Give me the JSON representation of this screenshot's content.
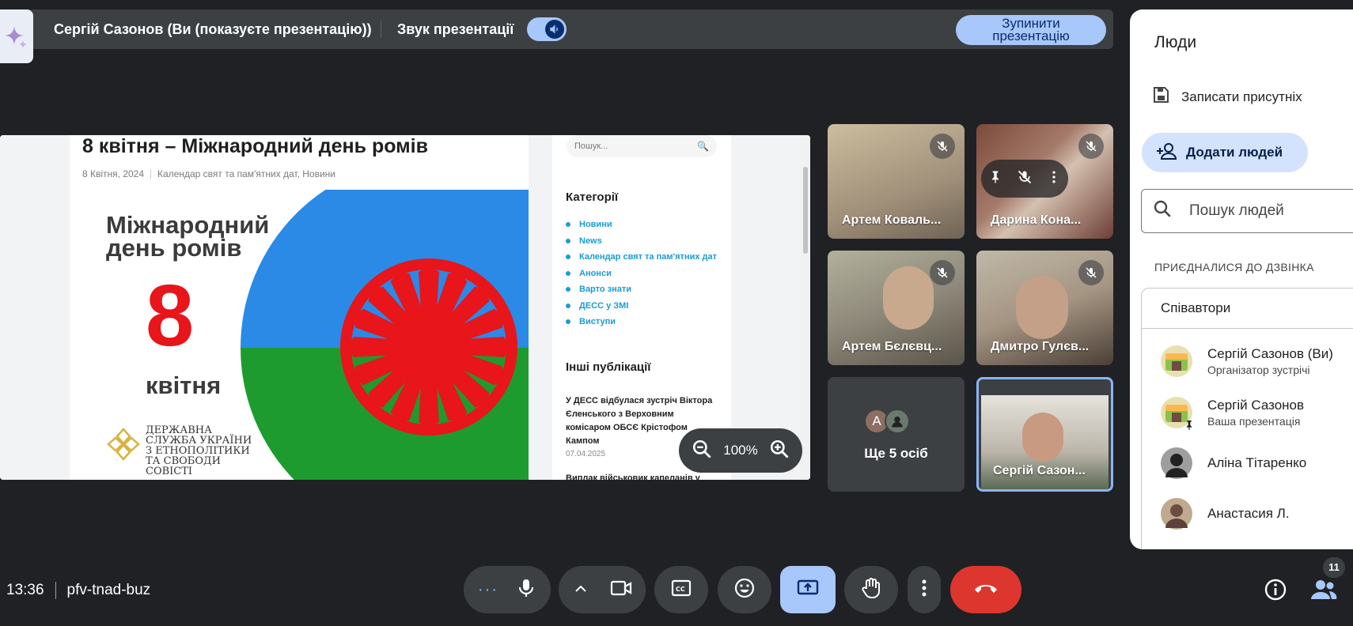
{
  "top_bar": {
    "presenter": "Сергій Сазонов (Ви (показуєте презентацію))",
    "sound_label": "Звук презентації",
    "stop_label": "Зупинити презентацію"
  },
  "presentation": {
    "article_title": "8 квітня – Міжнародний день ромів",
    "article_date": "8 Квітня, 2024",
    "article_categories": "Календар свят та пам'ятних дат, Новини",
    "poster": {
      "title_line1": "Міжнародний",
      "title_line2": "день ромів",
      "day": "8",
      "month": "квітня",
      "agency_lines": [
        "Державна",
        "служба України",
        "з етнополітики",
        "та свободи",
        "совісті"
      ]
    },
    "search_placeholder": "Пошук...",
    "categories_heading": "Категорії",
    "categories": [
      "Новини",
      "News",
      "Календар свят та пам'ятних дат",
      "Анонси",
      "Варто знати",
      "ДЕСС у ЗМІ",
      "Виступи"
    ],
    "other_heading": "Інші публікації",
    "publication_title": "У ДЕСС відбулася зустріч Віктора Єленського з Верховним комісаром ОБСЄ Крістофом Кампом",
    "publication_date": "07.04.2025",
    "next_publication": "Виплак військовик капеланів у",
    "zoom_level": "100%"
  },
  "participants": {
    "tiles": [
      {
        "name": "Артем Коваль..."
      },
      {
        "name": "Дарина Кона..."
      },
      {
        "name": "Артем Бєлєвц..."
      },
      {
        "name": "Дмитро Гулєв..."
      }
    ],
    "more_label": "Ще 5 осіб",
    "more_avatar_letter": "А",
    "self_name": "Сергій Сазон..."
  },
  "people_panel": {
    "title": "Люди",
    "record_label": "Записати присутніх",
    "add_label": "Додати людей",
    "search_placeholder": "Пошук людей",
    "joined_heading": "ПРИЄДНАЛИСЯ ДО ДЗВІНКА",
    "collaborators_heading": "Співавтори",
    "people": [
      {
        "name": "Сергій Сазонов (Ви)",
        "sub": "Організатор зустрічі"
      },
      {
        "name": "Сергій Сазонов",
        "sub": "Ваша презентація"
      },
      {
        "name": "Аліна Тітаренко",
        "sub": ""
      },
      {
        "name": "Анастасия Л.",
        "sub": ""
      }
    ]
  },
  "bottom_bar": {
    "time": "13:36",
    "meeting_code": "pfv-tnad-buz",
    "participant_count": "11"
  },
  "colors": {
    "accent": "#a8c7fa",
    "leave": "#dc362e",
    "surface": "#3c4043",
    "background": "#202124",
    "roma_blue": "#2a8ae6",
    "roma_green": "#1e9b2e",
    "roma_red": "#e8151b"
  }
}
